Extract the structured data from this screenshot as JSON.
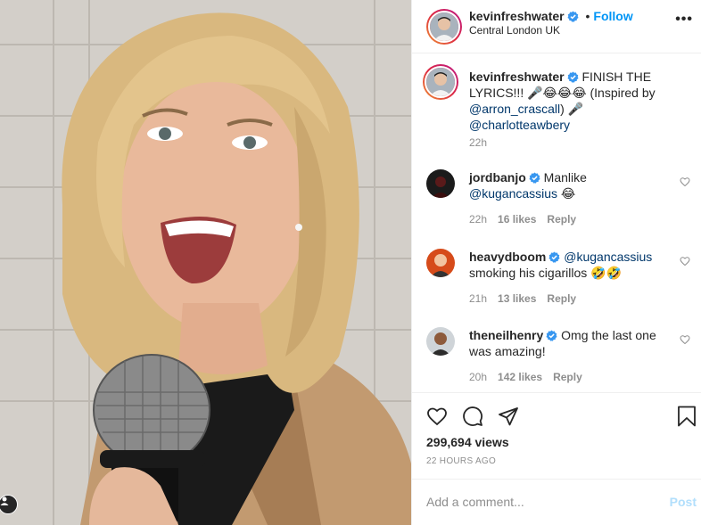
{
  "post": {
    "username": "kevinfreshwater",
    "follow_label": "Follow",
    "separator": "•",
    "location": "Central London UK",
    "more_label": "•••"
  },
  "caption": {
    "username": "kevinfreshwater",
    "text": "FINISH THE LYRICS!!! 🎤😂😂😂 (Inspired by",
    "mention1": "@arron_crascall",
    "text2": ") 🎤 ",
    "mention2": "@charlotteawbery",
    "time": "22h"
  },
  "comments": [
    {
      "username": "jordbanjo",
      "text_pre": "Manlike ",
      "mention": "@kugancassius",
      "text_post": " 😂",
      "time": "22h",
      "likes": "16 likes",
      "reply": "Reply"
    },
    {
      "username": "heavydboom",
      "text_pre": "",
      "mention": "@kugancassius",
      "text_post": " smoking his cigarillos 🤣🤣",
      "time": "21h",
      "likes": "13 likes",
      "reply": "Reply"
    },
    {
      "username": "theneilhenry",
      "text_pre": "Omg the last one was amazing!",
      "mention": "",
      "text_post": "",
      "time": "20h",
      "likes": "142 likes",
      "reply": "Reply"
    }
  ],
  "stats": {
    "views": "299,694 views",
    "timestamp": "22 HOURS AGO"
  },
  "composer": {
    "placeholder": "Add a comment...",
    "post_label": "Post"
  },
  "icons": {
    "like": "heart-icon",
    "comment": "comment-icon",
    "share": "share-icon",
    "save": "bookmark-icon",
    "verified": "verified-badge-icon",
    "tag": "user-tag-icon"
  },
  "colors": {
    "accent": "#0095f6",
    "verified": "#3897f0",
    "text": "#262626",
    "muted": "#8e8e8e",
    "post_disabled": "#b2dffc"
  }
}
